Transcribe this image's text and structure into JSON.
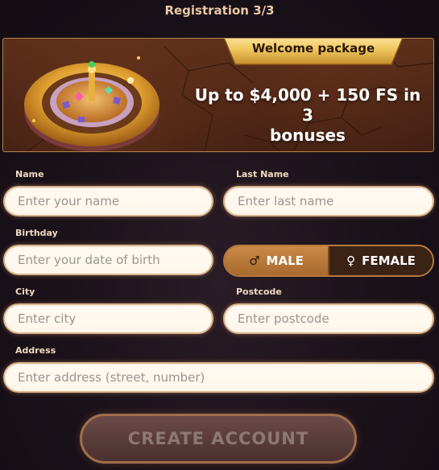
{
  "header": {
    "title": "Registration 3/3"
  },
  "banner": {
    "ribbon": "Welcome package",
    "promo_line1": "Up to $4,000 + 150 FS in 3",
    "promo_line2": "bonuses"
  },
  "form": {
    "name": {
      "label": "Name",
      "placeholder": "Enter your name"
    },
    "last_name": {
      "label": "Last Name",
      "placeholder": "Enter last name"
    },
    "birthday": {
      "label": "Birthday",
      "placeholder": "Enter your date of birth"
    },
    "gender": {
      "male": {
        "label": "MALE",
        "symbol": "♂"
      },
      "female": {
        "label": "FEMALE",
        "symbol": "♀"
      },
      "selected": "male"
    },
    "city": {
      "label": "City",
      "placeholder": "Enter city"
    },
    "postcode": {
      "label": "Postcode",
      "placeholder": "Enter postcode"
    },
    "address": {
      "label": "Address",
      "placeholder": "Enter address (street, number)"
    }
  },
  "cta": {
    "label": "CREATE ACCOUNT"
  },
  "colors": {
    "accent": "#c98a46",
    "banner_border": "#b8834a",
    "background": "#1a1119"
  }
}
